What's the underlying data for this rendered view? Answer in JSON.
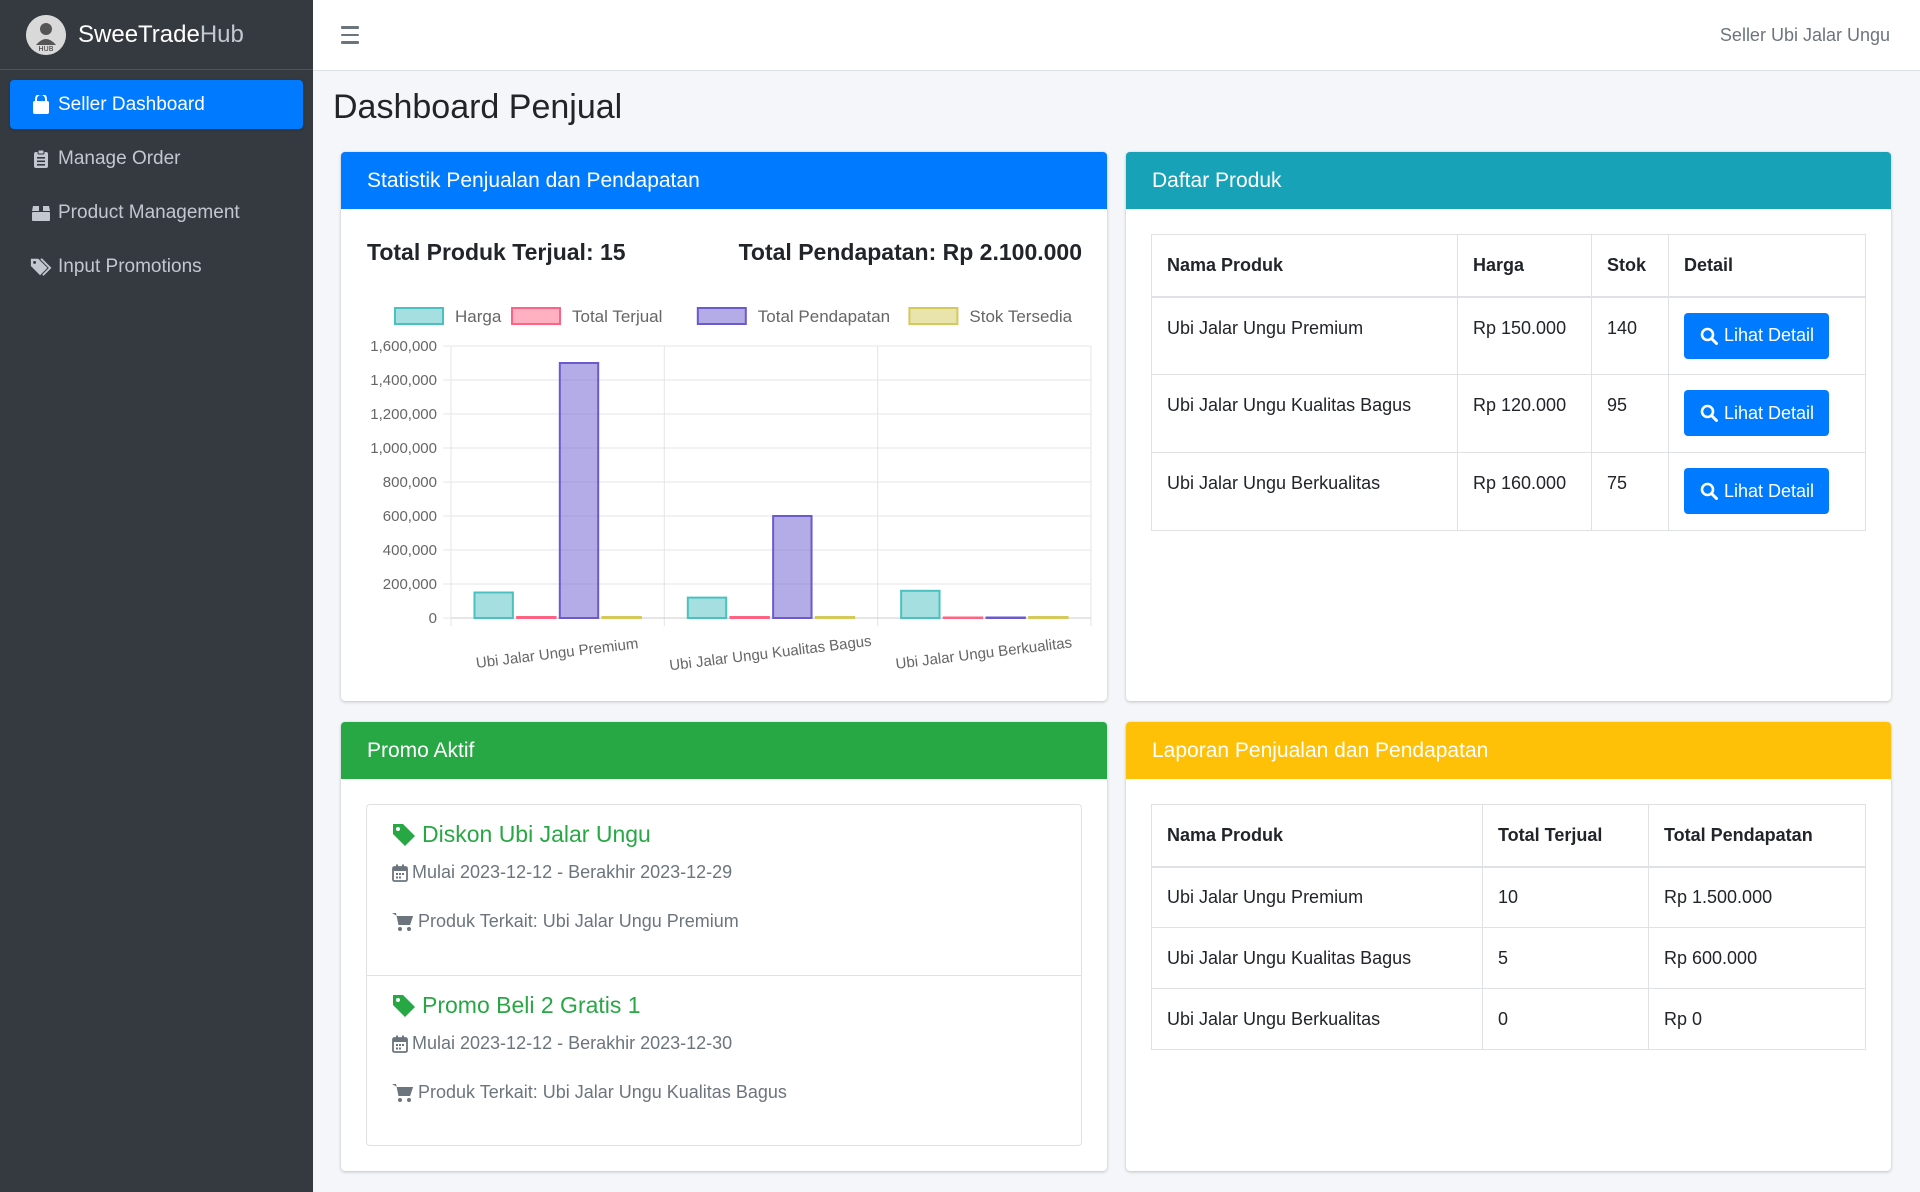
{
  "brand": {
    "name_bold": "SweeTrade",
    "name_light": "Hub",
    "logo_text": "HUB"
  },
  "sidebar": {
    "items": [
      {
        "label": "Seller Dashboard",
        "icon": "shopping-bag-icon",
        "active": true
      },
      {
        "label": "Manage Order",
        "icon": "clipboard-icon",
        "active": false
      },
      {
        "label": "Product Management",
        "icon": "box-icon",
        "active": false
      },
      {
        "label": "Input Promotions",
        "icon": "tags-icon",
        "active": false
      }
    ]
  },
  "topbar": {
    "user": "Seller Ubi Jalar Ungu"
  },
  "page": {
    "title": "Dashboard Penjual"
  },
  "stats": {
    "header": "Statistik Penjualan dan Pendapatan",
    "total_sold": "Total Produk Terjual: 15",
    "total_revenue": "Total Pendapatan: Rp 2.100.000"
  },
  "chart_data": {
    "type": "bar",
    "categories": [
      "Ubi Jalar Ungu Premium",
      "Ubi Jalar Ungu Kualitas Bagus",
      "Ubi Jalar Ungu Berkualitas"
    ],
    "series": [
      {
        "name": "Harga",
        "values": [
          150000,
          120000,
          160000
        ],
        "color": "#4bc0c0"
      },
      {
        "name": "Total Terjual",
        "values": [
          10,
          5,
          0
        ],
        "color": "#ff6384"
      },
      {
        "name": "Total Pendapatan",
        "values": [
          1500000,
          600000,
          0
        ],
        "color": "#6a5acd"
      },
      {
        "name": "Stok Tersedia",
        "values": [
          140,
          95,
          75
        ],
        "color": "#d4c95a"
      }
    ],
    "ylim": [
      0,
      1600000
    ],
    "yticks": [
      "1,600,000",
      "1,400,000",
      "1,200,000",
      "1,000,000",
      "800,000",
      "600,000",
      "400,000",
      "200,000",
      "0"
    ],
    "legend_position": "top",
    "grid": true
  },
  "products": {
    "header": "Daftar Produk",
    "columns": [
      "Nama Produk",
      "Harga",
      "Stok",
      "Detail"
    ],
    "rows": [
      {
        "name": "Ubi Jalar Ungu Premium",
        "price": "Rp 150.000",
        "stock": "140"
      },
      {
        "name": "Ubi Jalar Ungu Kualitas Bagus",
        "price": "Rp 120.000",
        "stock": "95"
      },
      {
        "name": "Ubi Jalar Ungu Berkualitas",
        "price": "Rp 160.000",
        "stock": "75"
      }
    ],
    "button_label": "Lihat Detail"
  },
  "promo": {
    "header": "Promo Aktif",
    "items": [
      {
        "title": "Diskon Ubi Jalar Ungu",
        "dates": "Mulai 2023-12-12 - Berakhir 2023-12-29",
        "product": "Produk Terkait: Ubi Jalar Ungu Premium"
      },
      {
        "title": "Promo Beli 2 Gratis 1",
        "dates": "Mulai 2023-12-12 - Berakhir 2023-12-30",
        "product": "Produk Terkait: Ubi Jalar Ungu Kualitas Bagus"
      }
    ]
  },
  "report": {
    "header": "Laporan Penjualan dan Pendapatan",
    "columns": [
      "Nama Produk",
      "Total Terjual",
      "Total Pendapatan"
    ],
    "rows": [
      {
        "name": "Ubi Jalar Ungu Premium",
        "sold": "10",
        "revenue": "Rp 1.500.000"
      },
      {
        "name": "Ubi Jalar Ungu Kualitas Bagus",
        "sold": "5",
        "revenue": "Rp 600.000"
      },
      {
        "name": "Ubi Jalar Ungu Berkualitas",
        "sold": "0",
        "revenue": "Rp 0"
      }
    ]
  }
}
